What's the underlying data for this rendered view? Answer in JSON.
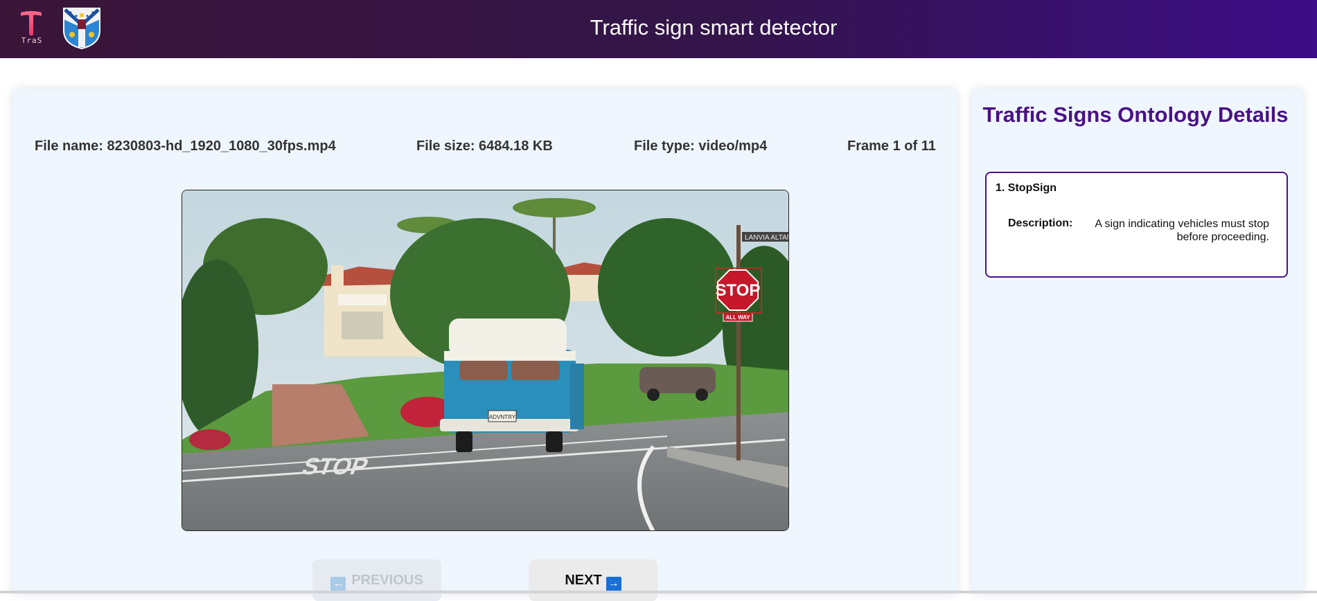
{
  "header": {
    "title": "Traffic sign smart detector",
    "logo_text": "TraS",
    "brand_colors": {
      "header_start": "#3a1538",
      "header_end": "#3b0d86"
    }
  },
  "file_info": {
    "name": "File name: 8230803-hd_1920_1080_30fps.mp4",
    "size": "File size: 6484.18 KB",
    "type": "File type: video/mp4",
    "frame": "Frame 1 of 11"
  },
  "video": {
    "street_sign_text": "LANVIA ALTAMI",
    "stop_sign_text": "STOP",
    "stop_sub_text": "ALL WAY",
    "road_marking_text": "STOP",
    "plate_text": "ADVNTRY",
    "detection_box_color": "#e02020"
  },
  "navigation": {
    "previous_label": "PREVIOUS",
    "next_label": "NEXT",
    "previous_icon": "left-arrow-icon",
    "next_icon": "right-arrow-icon"
  },
  "ontology": {
    "title": "Traffic Signs Ontology Details",
    "items": [
      {
        "name": "1. StopSign",
        "description_label": "Description:",
        "description": "A sign indicating vehicles must stop before proceeding."
      }
    ]
  }
}
